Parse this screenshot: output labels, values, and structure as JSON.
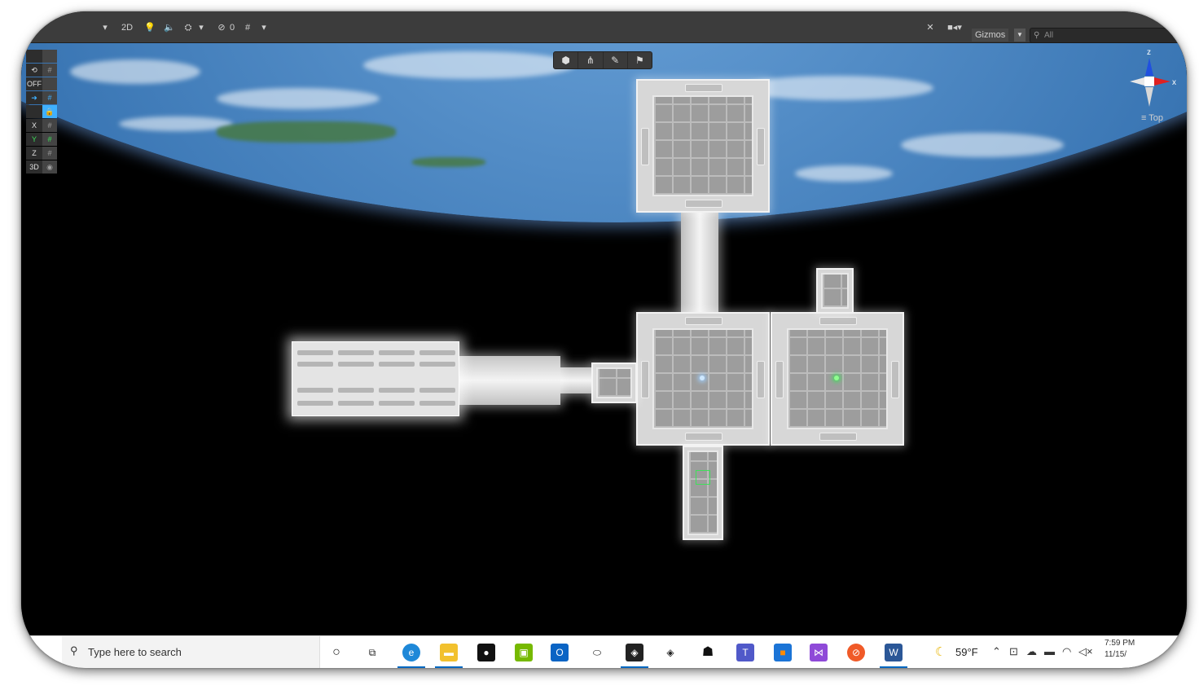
{
  "toolbar": {
    "mode_2d": "2D",
    "hidden_count": "0",
    "gizmos_label": "Gizmos",
    "search_placeholder": "All"
  },
  "overlay_tools": [
    "cube-icon",
    "nodes-icon",
    "pen-icon",
    "flag-icon"
  ],
  "left_panel": {
    "rows": [
      {
        "a": "",
        "b": ""
      },
      {
        "a": "⟲",
        "b": "#"
      },
      {
        "a": "OFF",
        "b": ""
      },
      {
        "a": "➜",
        "b": "#"
      },
      {
        "a": "",
        "b": "🔒"
      },
      {
        "a": "X",
        "b": "#"
      },
      {
        "a": "Y",
        "b": "#"
      },
      {
        "a": "Z",
        "b": "#"
      },
      {
        "a": "3D",
        "b": "◉"
      }
    ]
  },
  "orientation": {
    "view_label": "Top",
    "axis_z": "z",
    "axis_x": "x"
  },
  "taskbar": {
    "search_placeholder": "Type here to search",
    "weather_temp": "59°F",
    "time": "7:59 PM",
    "date": "11/15/",
    "apps": [
      "cortana-icon",
      "task-view-icon",
      "edge-icon",
      "file-explorer-icon",
      "app-dark-icon",
      "nvidia-icon",
      "outlook-icon",
      "oculus-icon",
      "unity-icon",
      "unity-hub-icon",
      "alienware-icon",
      "teams-icon",
      "app-orange-icon",
      "visual-studio-icon",
      "app-red-icon",
      "word-icon"
    ]
  },
  "colors": {
    "editor_toolbar": "#3c3c3c",
    "taskbar_accent": "#0067c0",
    "axis_x": "#e02020",
    "axis_y": "#20c020",
    "axis_z": "#2050e0"
  }
}
